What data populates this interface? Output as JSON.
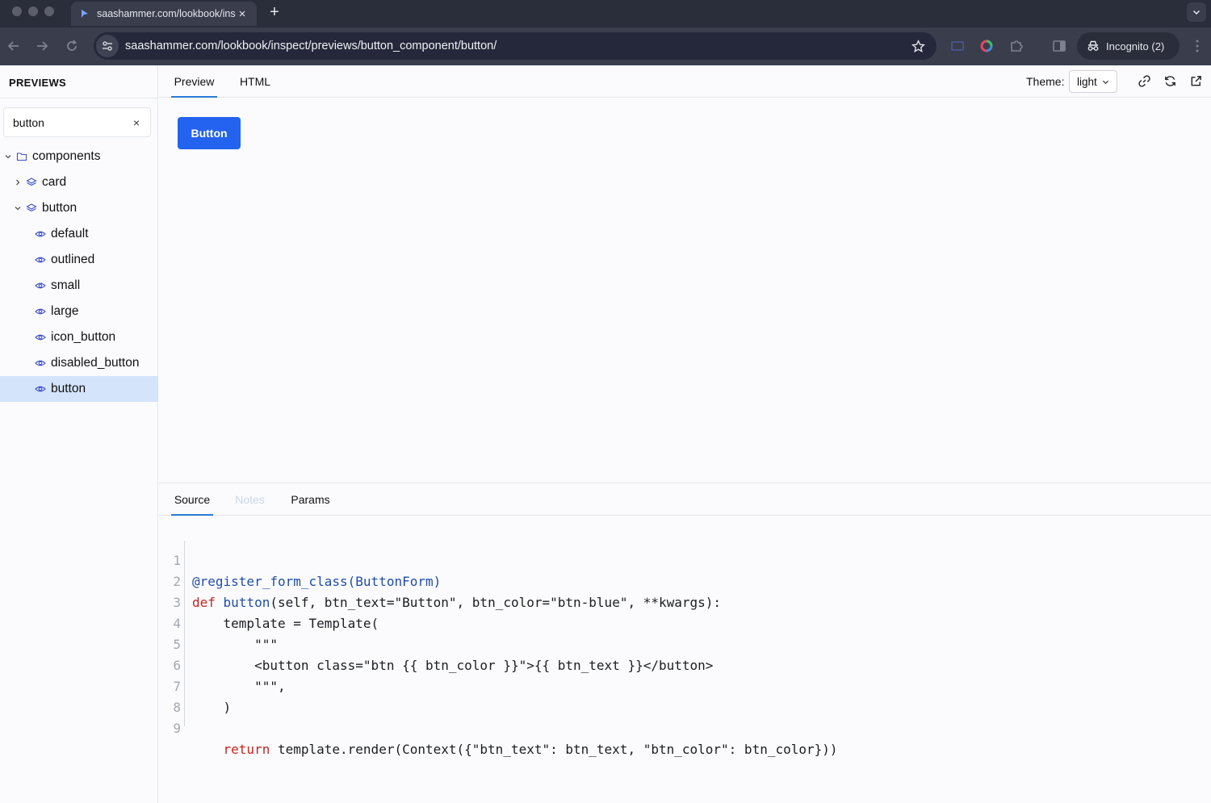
{
  "browser": {
    "tab_title": "saashammer.com/lookbook/ins",
    "url": "saashammer.com/lookbook/inspect/previews/button_component/button/",
    "incognito_label": "Incognito (2)"
  },
  "sidebar": {
    "title": "PREVIEWS",
    "search_value": "button",
    "tree": {
      "root": "components",
      "card": "card",
      "button": "button",
      "previews": [
        "default",
        "outlined",
        "small",
        "large",
        "icon_button",
        "disabled_button",
        "button"
      ]
    }
  },
  "main": {
    "tabs": [
      "Preview",
      "HTML"
    ],
    "theme_label": "Theme:",
    "theme_value": "light",
    "preview_button_label": "Button"
  },
  "bottom": {
    "tabs": [
      "Source",
      "Notes",
      "Params"
    ],
    "line_numbers": [
      "1",
      "2",
      "3",
      "4",
      "5",
      "6",
      "7",
      "8",
      "9"
    ],
    "code": {
      "l1": "@register_form_class(ButtonForm)",
      "l2_kw": "def",
      "l2_fn": "button",
      "l2_rest": "(self, btn_text=\"Button\", btn_color=\"btn-blue\", **kwargs):",
      "l3": "    template = Template(",
      "l4": "        \"\"\"",
      "l5": "        <button class=\"btn {{ btn_color }}\">{{ btn_text }}</button>",
      "l6": "        \"\"\",",
      "l7": "    )",
      "l8": "",
      "l9_indent": "    ",
      "l9_kw": "return",
      "l9_rest": " template.render(Context({\"btn_text\": btn_text, \"btn_color\": btn_color}))"
    }
  },
  "colors": {
    "accent": "#2462f0",
    "tab_underline": "#2a7bd6",
    "selected_row": "#d4e4fb",
    "icon_blue": "#3d4fc7"
  }
}
